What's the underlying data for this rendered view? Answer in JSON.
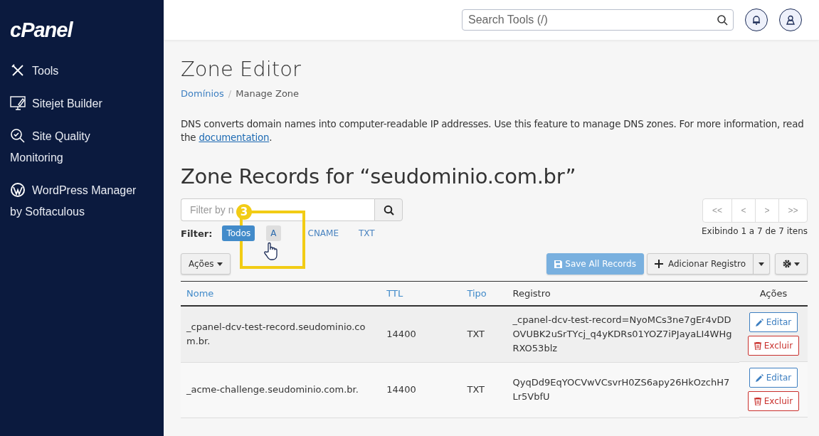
{
  "sidebar": {
    "logo": "cPanel",
    "items": [
      {
        "kind": "tools",
        "label": "Tools"
      },
      {
        "kind": "sitejet",
        "label": "Sitejet Builder"
      },
      {
        "kind": "quality",
        "label": "Site Quality Monitoring"
      },
      {
        "kind": "wordpress",
        "label": "WordPress Manager by Softaculous"
      }
    ]
  },
  "header": {
    "search": {
      "placeholder": "Search Tools (/)"
    }
  },
  "page": {
    "title": "Zone Editor",
    "breadcrumb": {
      "separator": "/",
      "items": [
        {
          "label": "Domínios",
          "link": true
        },
        {
          "label": "Manage Zone",
          "link": false
        }
      ]
    },
    "description": {
      "text": "DNS converts domain names into computer-readable IP addresses. Use this feature to manage DNS zones. For more information, read the ",
      "link": "documentation",
      "end": "."
    },
    "heading": "Zone Records for “seudominio.com.br”"
  },
  "filter": {
    "placeholder": "Filter by n",
    "label": "Filter:",
    "types": [
      {
        "label": "Todos",
        "selected": true,
        "hovered": false
      },
      {
        "label": "A",
        "selected": false,
        "hovered": true
      },
      {
        "label": "CNAME",
        "selected": false,
        "hovered": false
      },
      {
        "label": "TXT",
        "selected": false,
        "hovered": false
      }
    ]
  },
  "pagination": {
    "buttons": [
      "<<",
      "<",
      ">",
      ">>"
    ],
    "info": "Exibindo 1 a 7 de 7 itens"
  },
  "toolbar": {
    "actions": "Ações",
    "save": "Save All Records",
    "add": "Adicionar Registro"
  },
  "table": {
    "columns": [
      {
        "label": "Nome",
        "sortable": true
      },
      {
        "label": "TTL",
        "sortable": true
      },
      {
        "label": "Tipo",
        "sortable": true
      },
      {
        "label": "Registro",
        "sortable": false
      },
      {
        "label": "Ações",
        "sortable": false
      }
    ],
    "rows": [
      {
        "name": "_cpanel-dcv-test-record.seudominio.com.br.",
        "ttl": "14400",
        "type": "TXT",
        "record": "_cpanel-dcv-test-record=NyoMCs3ne7gEr4vDDOVUBK2uSrTYcj_q4yKDRs01YOZ7iPJayaLI4WHgRXO53blz",
        "edit": "Editar",
        "delete": "Excluir"
      },
      {
        "name": "_acme-challenge.seudominio.com.br.",
        "ttl": "14400",
        "type": "TXT",
        "record": "QyqDd9EqYOCVwVCsvrH0ZS6apy26HkOzchH7Lr5VbfU",
        "edit": "Editar",
        "delete": "Excluir"
      }
    ]
  },
  "annotation": {
    "step": "3"
  }
}
